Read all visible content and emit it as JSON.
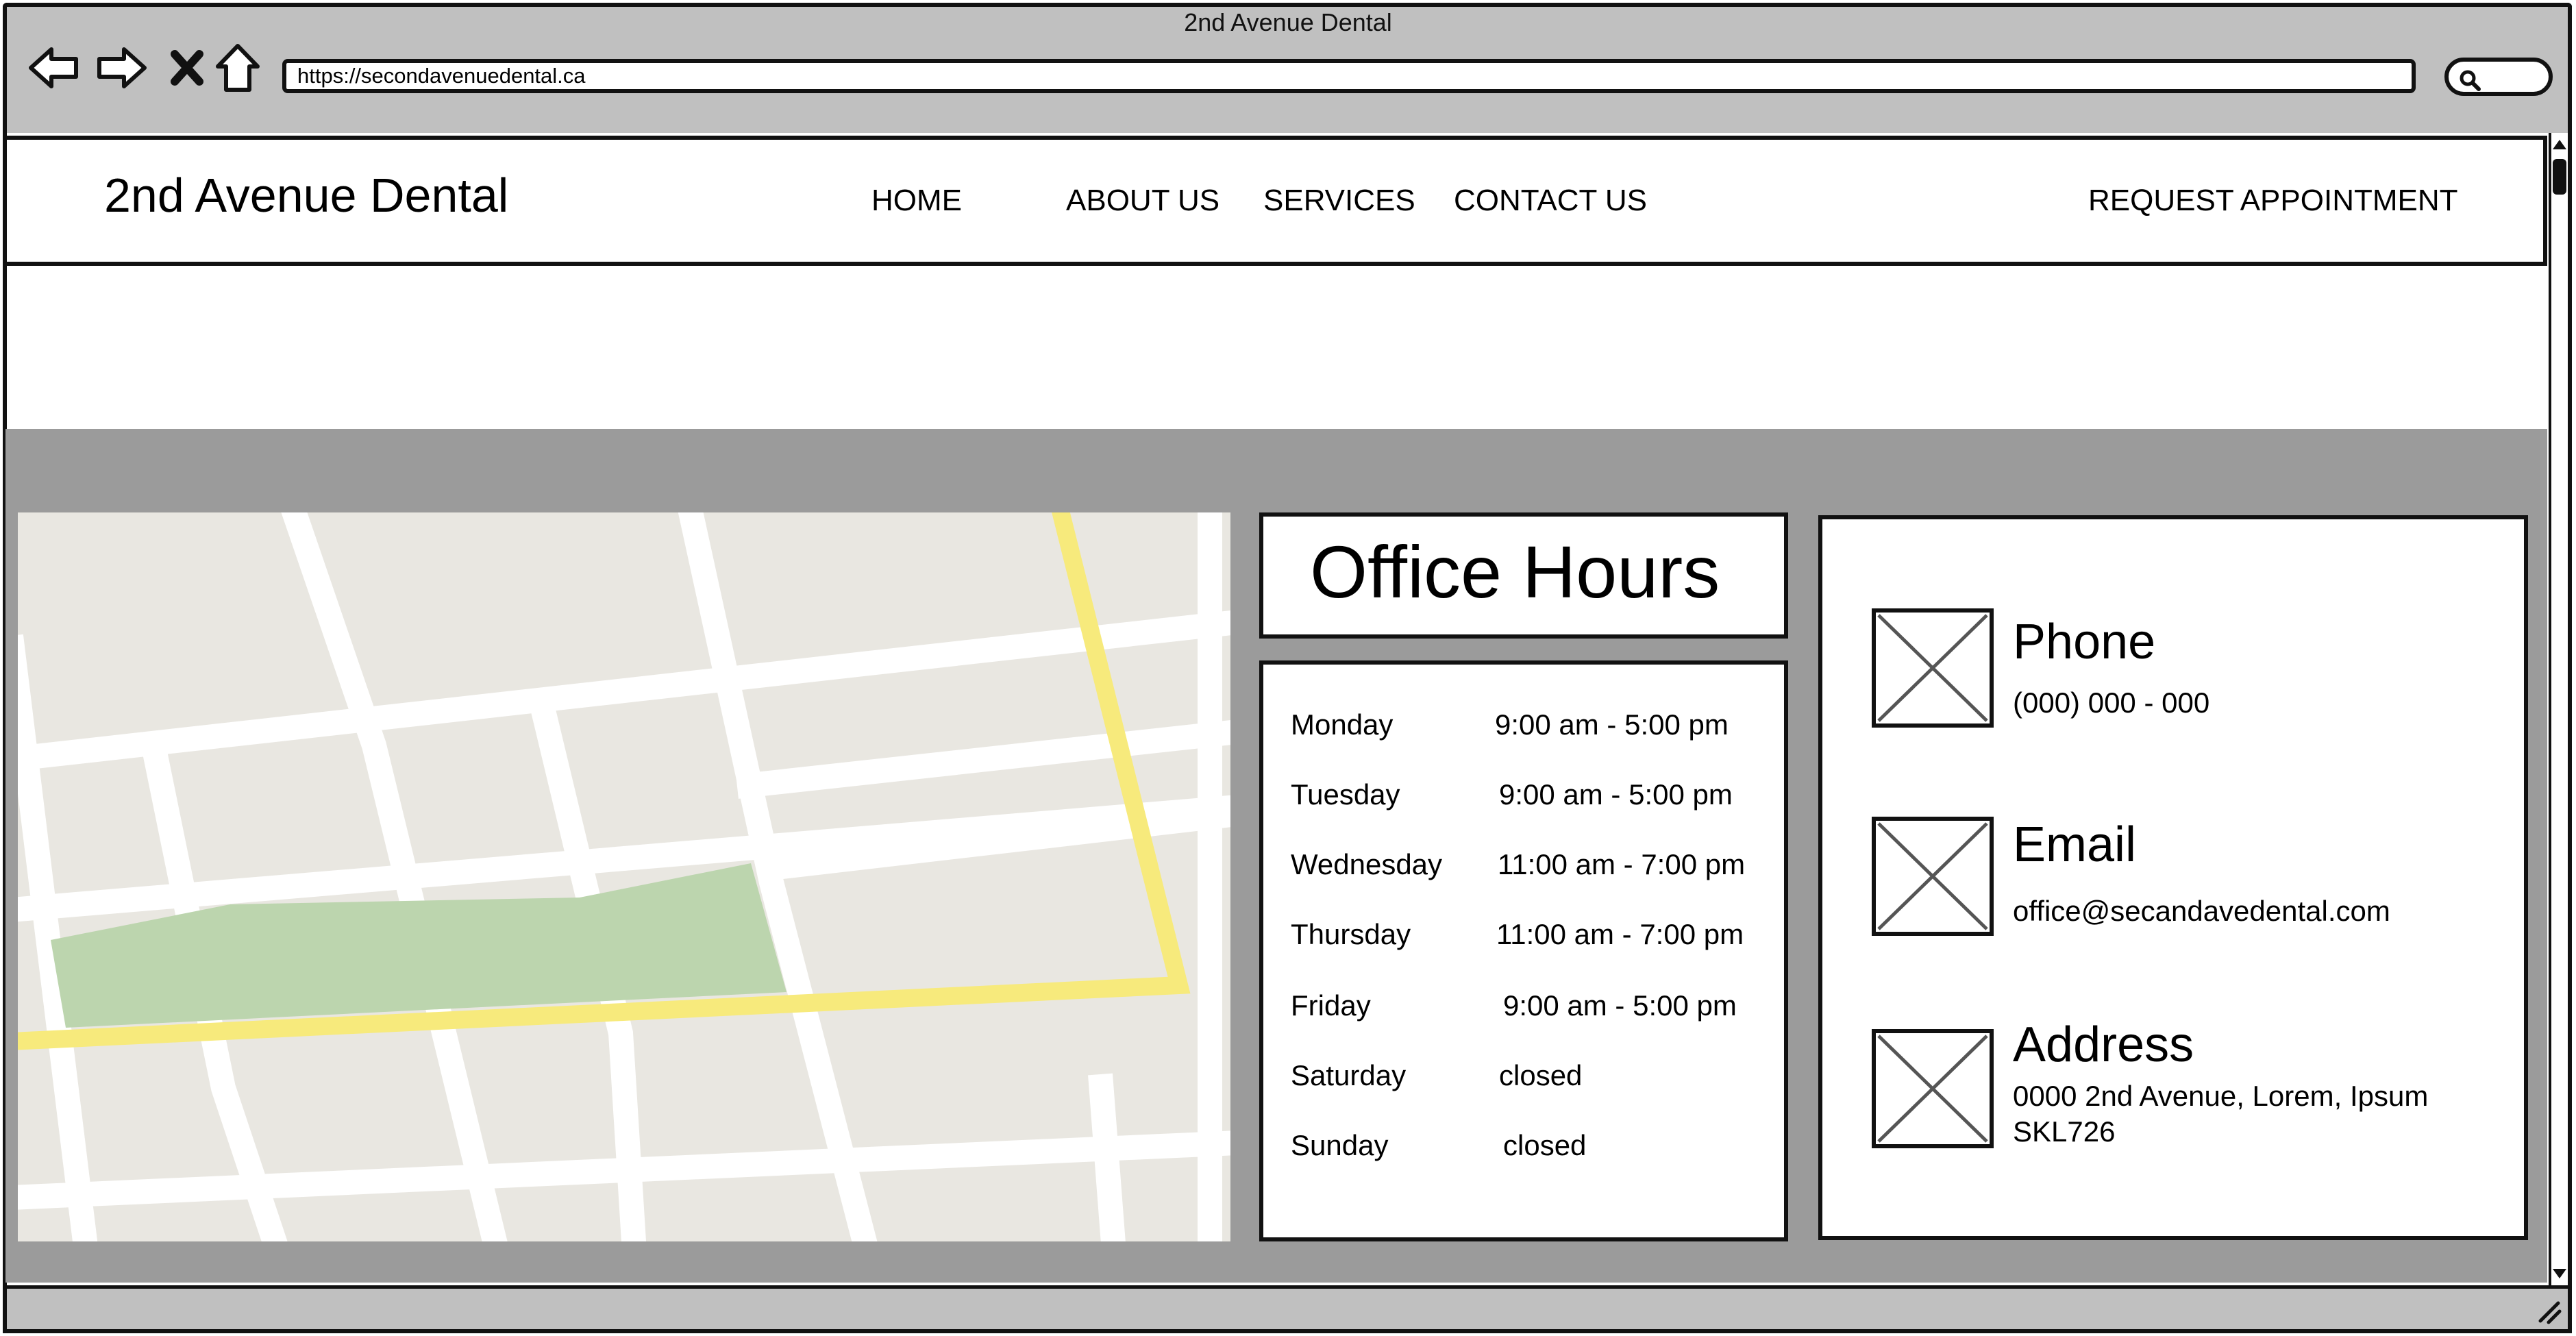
{
  "browser": {
    "window_title": "2nd Avenue Dental",
    "url": "https://secondavenuedental.ca",
    "icons": [
      "back-arrow-icon",
      "forward-arrow-icon",
      "close-x-icon",
      "home-icon",
      "search-icon"
    ]
  },
  "header": {
    "brand": "2nd Avenue Dental",
    "nav": [
      "HOME",
      "ABOUT US",
      "SERVICES",
      "CONTACT US"
    ],
    "cta": "REQUEST APPOINTMENT"
  },
  "hours": {
    "title": "Office Hours",
    "rows": [
      {
        "day": "Monday",
        "time": "9:00 am - 5:00 pm"
      },
      {
        "day": "Tuesday",
        "time": "9:00 am - 5:00 pm"
      },
      {
        "day": "Wednesday",
        "time": "11:00 am - 7:00 pm"
      },
      {
        "day": "Thursday",
        "time": "11:00 am - 7:00 pm"
      },
      {
        "day": "Friday",
        "time": "9:00 am - 5:00 pm"
      },
      {
        "day": "Saturday",
        "time": "closed"
      },
      {
        "day": "Sunday",
        "time": "closed"
      }
    ]
  },
  "contact": {
    "phone": {
      "title": "Phone",
      "value": "(000) 000 - 000"
    },
    "email": {
      "title": "Email",
      "value": "office@secandavedental.com"
    },
    "address": {
      "title": "Address",
      "line1": "0000 2nd Avenue, Lorem, Ipsum",
      "line2": "SKL726"
    }
  },
  "colors": {
    "chrome": "#c0c0c0",
    "content_band": "#9b9b9b",
    "map_land": "#e9e7e1",
    "map_park": "#bcd5ae",
    "map_highway": "#f7ea7c",
    "map_road": "#ffffff"
  }
}
